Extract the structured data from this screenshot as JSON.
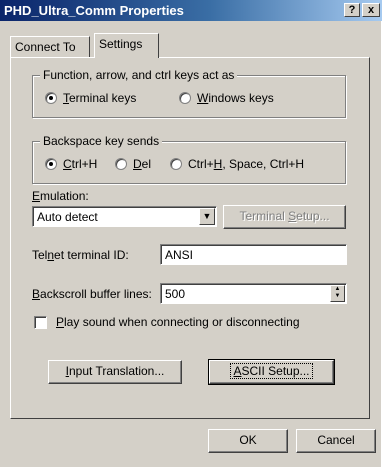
{
  "window": {
    "title": "PHD_Ultra_Comm Properties",
    "help_label": "?",
    "close_label": "x"
  },
  "tabs": [
    {
      "label": "Connect To",
      "active": false
    },
    {
      "label": "Settings",
      "active": true
    }
  ],
  "function_keys": {
    "group_label": "Function, arrow, and ctrl keys act as",
    "options": [
      {
        "mnemonic": "T",
        "rest": "erminal keys",
        "checked": true
      },
      {
        "mnemonic": "W",
        "rest": "indows keys",
        "checked": false
      }
    ]
  },
  "backspace": {
    "group_label": "Backspace key sends",
    "options": [
      {
        "mnemonic": "C",
        "rest": "trl+H",
        "checked": true
      },
      {
        "mnemonic": "D",
        "rest": "el",
        "checked": false
      },
      {
        "prefix": "Ctrl+",
        "mnemonic": "H",
        "rest": ", Space, Ctrl+H",
        "checked": false
      }
    ]
  },
  "emulation": {
    "label_mnemonic": "E",
    "label_rest": "mulation:",
    "value": "Auto detect",
    "dropdown_glyph": "▼",
    "terminal_setup_prefix": "Terminal ",
    "terminal_setup_mnemonic": "S",
    "terminal_setup_rest": "etup..."
  },
  "telnet": {
    "label_prefix": "Tel",
    "label_mnemonic": "n",
    "label_rest": "et terminal ID:",
    "value": "ANSI"
  },
  "backscroll": {
    "label_mnemonic": "B",
    "label_rest": "ackscroll buffer lines:",
    "value": "500",
    "spin_up": "▲",
    "spin_down": "▼"
  },
  "play_sound": {
    "mnemonic": "P",
    "rest": "lay sound when connecting or disconnecting",
    "checked": false
  },
  "buttons": {
    "input_translation_mnemonic": "I",
    "input_translation_rest": "nput Translation...",
    "ascii_setup_mnemonic": "A",
    "ascii_setup_rest": "SCII Setup...",
    "ok": "OK",
    "cancel": "Cancel"
  }
}
